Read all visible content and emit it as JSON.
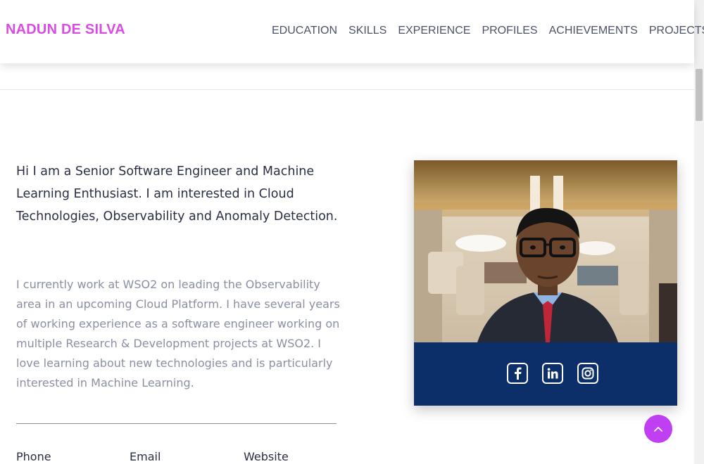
{
  "header": {
    "brand": "NADUN DE SILVA",
    "nav": [
      "EDUCATION",
      "SKILLS",
      "EXPERIENCE",
      "PROFILES",
      "ACHIEVEMENTS",
      "PROJECTS"
    ]
  },
  "intro": {
    "lead": "Hi I am a Senior Software Engineer and Machine Learning Enthusiast. I am interested in Cloud Technologies, Observability and Anomaly Detection.",
    "body": "I currently work at WSO2 on leading the Observability area in an upcoming Cloud Platform. I have several years of working experience as a software engineer working on multiple Research & Development projects at WSO2. I love learning about new technologies and is particularly interested in Machine Learning."
  },
  "contacts": [
    "Phone",
    "Email",
    "Website"
  ],
  "social": [
    {
      "icon": "facebook-icon"
    },
    {
      "icon": "linkedin-icon"
    },
    {
      "icon": "instagram-icon"
    }
  ],
  "colors": {
    "brand": "#d84ce2",
    "nav_text": "#4c5267",
    "heading": "#2a2e45",
    "body_text": "#8a8fa3",
    "card_bar": "#0c2f6a",
    "back_to_top": "#c03ff2"
  }
}
